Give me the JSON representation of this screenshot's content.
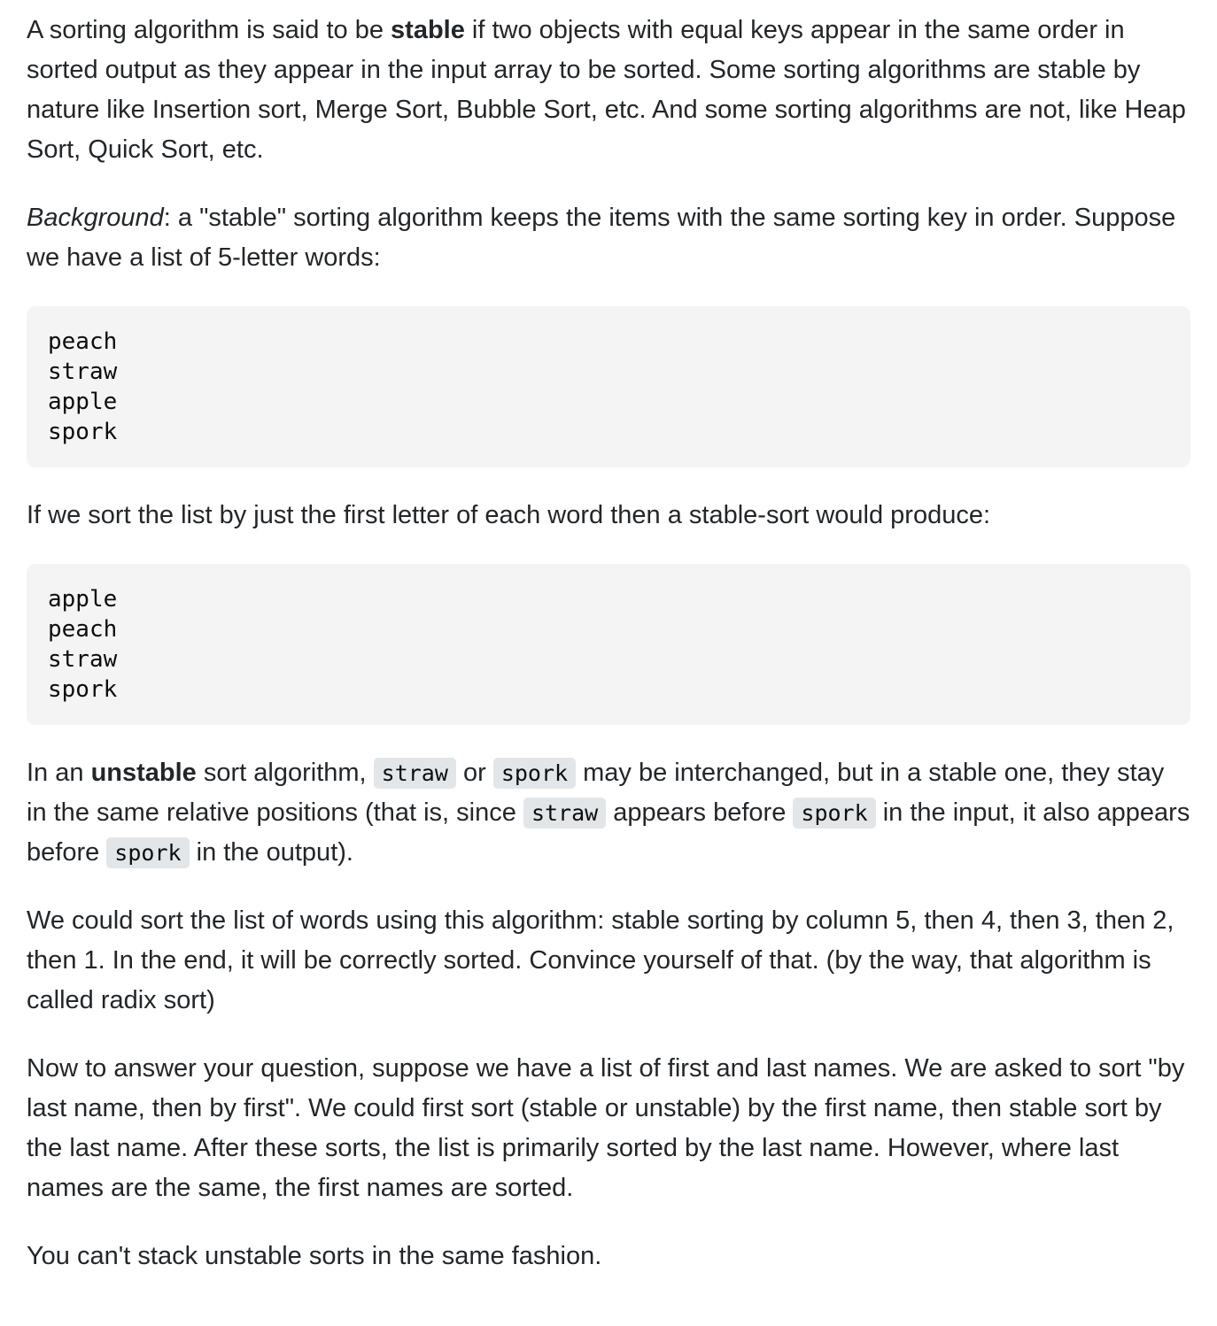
{
  "p1": {
    "before": "A sorting algorithm is said to be ",
    "bold": "stable",
    "after": " if two objects with equal keys appear in the same order in sorted output as they appear in the input array to be sorted. Some sorting algorithms are stable by nature like Insertion sort, Merge Sort, Bubble Sort, etc. And some sorting algorithms are not, like Heap Sort, Quick Sort, etc."
  },
  "p2": {
    "italic": "Background",
    "after": ": a \"stable\" sorting algorithm keeps the items with the same sorting key in order. Suppose we have a list of 5-letter words:"
  },
  "code1": [
    "peach",
    "straw",
    "apple",
    "spork"
  ],
  "p3": {
    "text": "If we sort the list by just the first letter of each word then a stable-sort would produce:"
  },
  "code2": [
    "apple",
    "peach",
    "straw",
    "spork"
  ],
  "p4": {
    "t1": "In an ",
    "bold": "unstable",
    "t2": " sort algorithm, ",
    "c1": "straw",
    "t3": " or ",
    "c2": "spork",
    "t4": " may be interchanged, but in a stable one, they stay in the same relative positions (that is, since ",
    "c3": "straw",
    "t5": " appears before ",
    "c4": "spork",
    "t6": " in the input, it also appears before ",
    "c5": "spork",
    "t7": " in the output)."
  },
  "p5": {
    "text": "We could sort the list of words using this algorithm: stable sorting by column 5, then 4, then 3, then 2, then 1. In the end, it will be correctly sorted. Convince yourself of that. (by the way, that algorithm is called radix sort)"
  },
  "p6": {
    "text": "Now to answer your question, suppose we have a list of first and last names. We are asked to sort \"by last name, then by first\". We could first sort (stable or unstable) by the first name, then stable sort by the last name. After these sorts, the list is primarily sorted by the last name. However, where last names are the same, the first names are sorted."
  },
  "p7": {
    "text": "You can't stack unstable sorts in the same fashion."
  }
}
